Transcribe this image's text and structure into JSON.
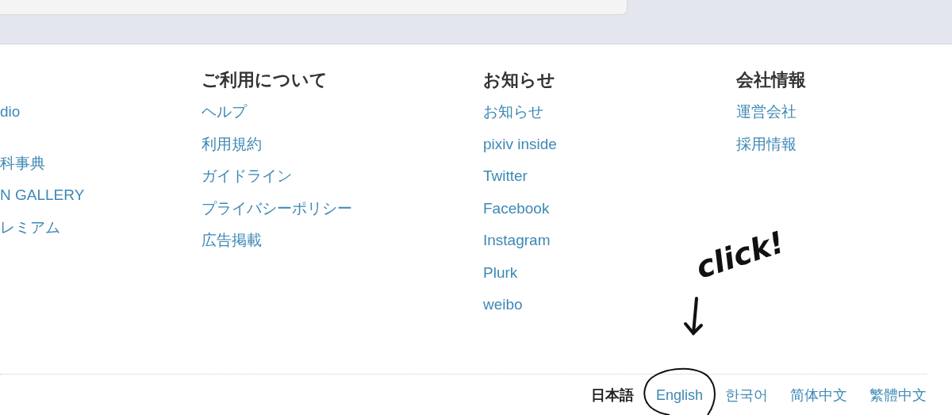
{
  "footer": {
    "columns": [
      {
        "links": [
          "dio",
          "科事典",
          "N GALLERY",
          "レミアム"
        ]
      },
      {
        "heading": "ご利用について",
        "links": [
          "ヘルプ",
          "利用規約",
          "ガイドライン",
          "プライバシーポリシー",
          "広告掲載"
        ]
      },
      {
        "heading": "お知らせ",
        "links": [
          "お知らせ",
          "pixiv inside",
          "Twitter",
          "Facebook",
          "Instagram",
          "Plurk",
          "weibo"
        ]
      },
      {
        "heading": "会社情報",
        "links": [
          "運営会社",
          "採用情報"
        ]
      }
    ],
    "languages": [
      {
        "label": "日本語",
        "selected": true
      },
      {
        "label": "English",
        "selected": false
      },
      {
        "label": "한국어",
        "selected": false
      },
      {
        "label": "简体中文",
        "selected": false
      },
      {
        "label": "繁體中文",
        "selected": false
      }
    ]
  },
  "annotation": {
    "text": "click!"
  }
}
